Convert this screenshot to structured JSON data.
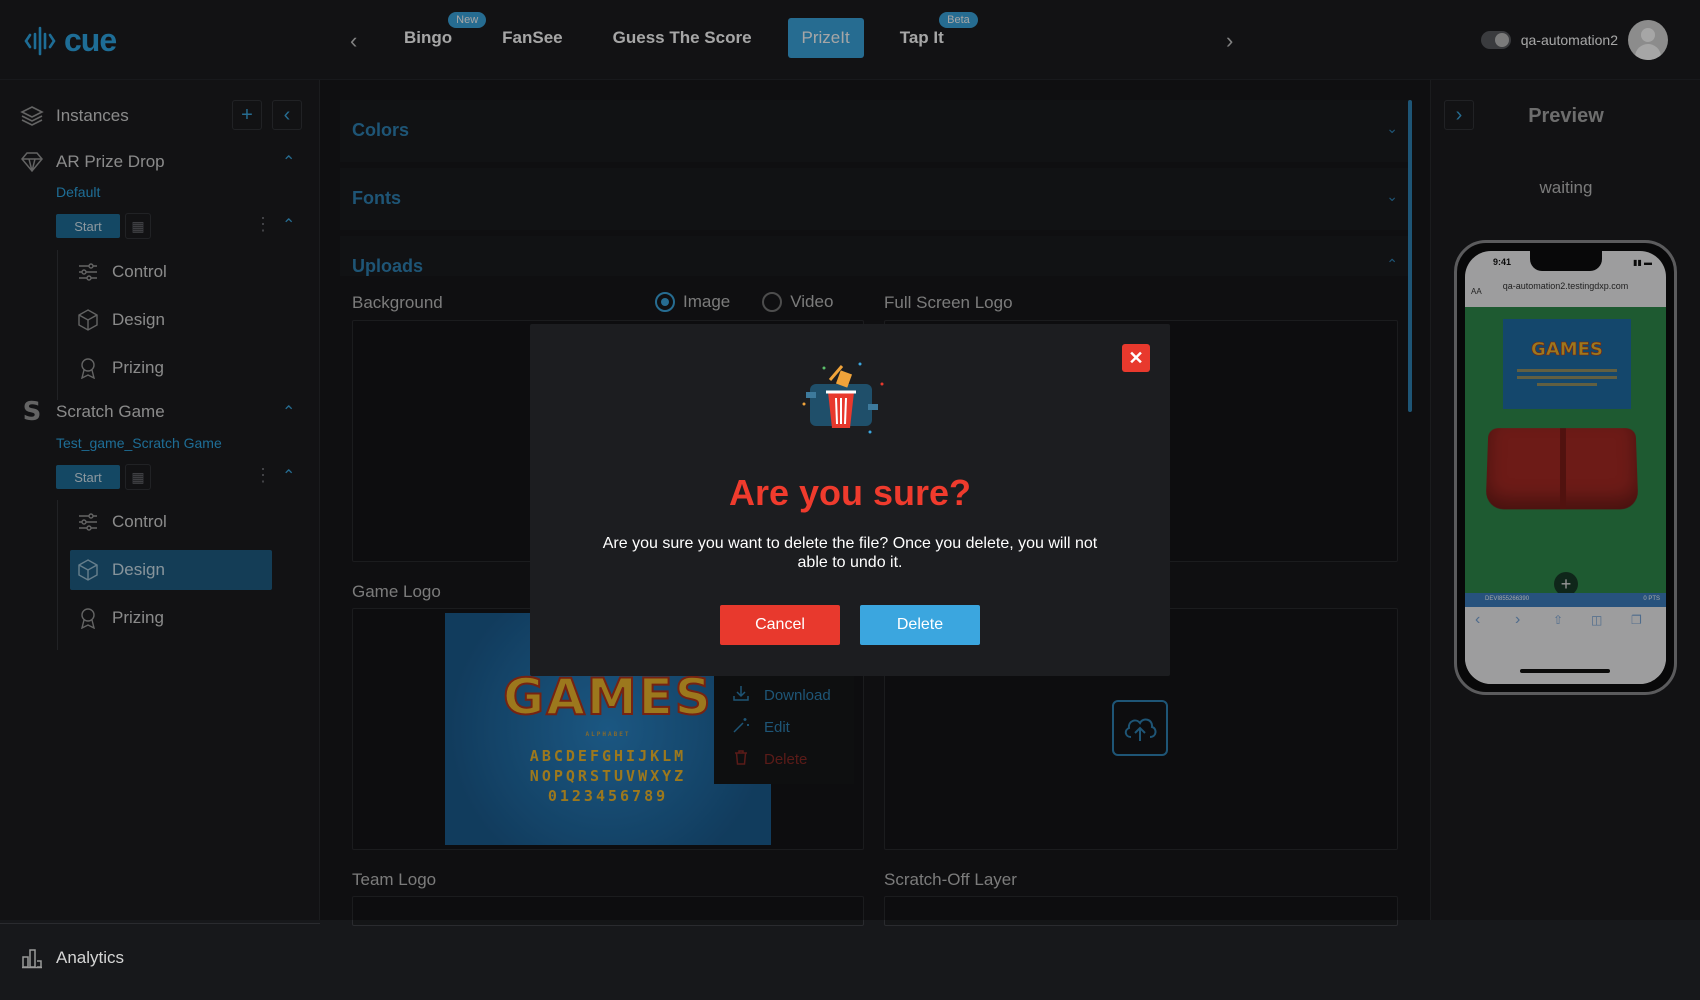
{
  "brand": {
    "name": "cue",
    "accent": "#3ba6df",
    "danger": "#e8392d"
  },
  "nav": {
    "tabs": [
      {
        "label": "Bingo",
        "badge": "New"
      },
      {
        "label": "FanSee",
        "badge": ""
      },
      {
        "label": "Guess The Score",
        "badge": ""
      },
      {
        "label": "PrizeIt",
        "badge": "",
        "active": true
      },
      {
        "label": "Tap It",
        "badge": "Beta"
      }
    ]
  },
  "user": {
    "name": "qa-automation2"
  },
  "sidebar": {
    "instances_label": "Instances",
    "games": [
      {
        "name": "AR Prize Drop",
        "instance": "Default",
        "start_label": "Start",
        "items": [
          "Control",
          "Design",
          "Prizing"
        ]
      },
      {
        "name": "Scratch Game",
        "instance": "Test_game_Scratch Game",
        "start_label": "Start",
        "items": [
          "Control",
          "Design",
          "Prizing"
        ],
        "active_item": "Design"
      }
    ],
    "analytics_label": "Analytics"
  },
  "main": {
    "sections": [
      {
        "title": "Colors",
        "expanded": false
      },
      {
        "title": "Fonts",
        "expanded": false
      },
      {
        "title": "Uploads",
        "expanded": true
      }
    ],
    "uploads": {
      "background_label": "Background",
      "background_options": [
        "Image",
        "Video"
      ],
      "background_selected": "Image",
      "full_screen_logo_label": "Full Screen Logo",
      "game_logo_label": "Game Logo",
      "team_logo_label": "Team Logo",
      "scratch_off_label": "Scratch-Off Layer",
      "game_logo_art": {
        "title": "GAMES",
        "alphabet_caption": "ALPHABET",
        "line1": "ABCDEFGHIJKLM",
        "line2": "NOPQRSTUVWXYZ",
        "line3": "0123456789"
      }
    },
    "context_menu": [
      "Download",
      "Edit",
      "Delete"
    ]
  },
  "modal": {
    "title": "Are you sure?",
    "message": "Are you sure you want to delete the file? Once you delete, you will not able to undo it.",
    "cancel_label": "Cancel",
    "delete_label": "Delete"
  },
  "preview": {
    "title": "Preview",
    "status": "waiting",
    "phone_time": "9:41",
    "url": "qa-automation2.testingdxp.com",
    "font_size_label": "AA",
    "footer_code": "DEVI855266390",
    "footer_points": "0 PTS",
    "card_title": "GAMES"
  }
}
